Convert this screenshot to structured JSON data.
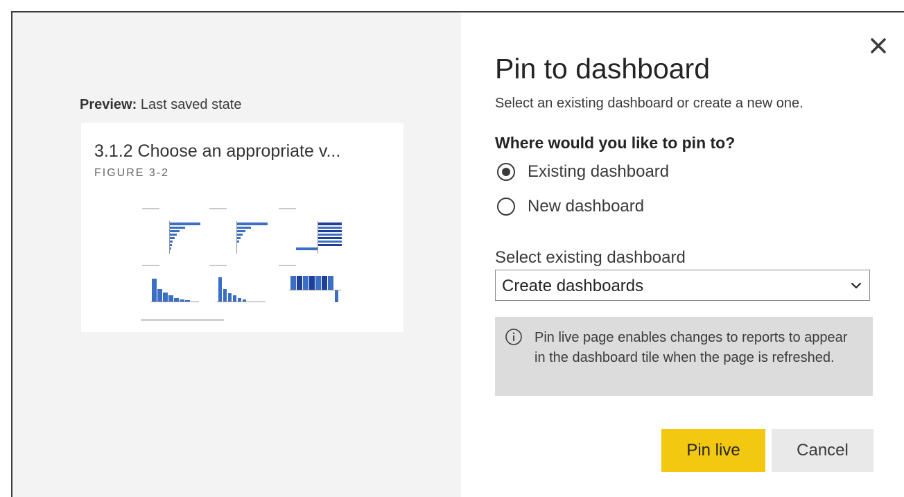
{
  "preview": {
    "label_bold": "Preview:",
    "label_rest": "Last saved state",
    "card_title": "3.1.2 Choose an appropriate v...",
    "card_subtitle": "FIGURE 3-2"
  },
  "dialog": {
    "title": "Pin to dashboard",
    "description": "Select an existing dashboard or create a new one.",
    "question": "Where would you like to pin to?",
    "options": [
      {
        "label": "Existing dashboard",
        "checked": true
      },
      {
        "label": "New dashboard",
        "checked": false
      }
    ],
    "select_label": "Select existing dashboard",
    "select_value": "Create dashboards",
    "info_text": "Pin live page enables changes to reports to appear in the dashboard tile when the page is refreshed.",
    "pin_button": "Pin live",
    "cancel_button": "Cancel"
  },
  "colors": {
    "accent_yellow": "#f2c811",
    "chart_blue": "#3a6fc4",
    "dark_blue": "#1f3f99"
  },
  "icons": {
    "close": "close-icon",
    "info": "info-icon",
    "dropdown": "chevron-down-icon"
  }
}
